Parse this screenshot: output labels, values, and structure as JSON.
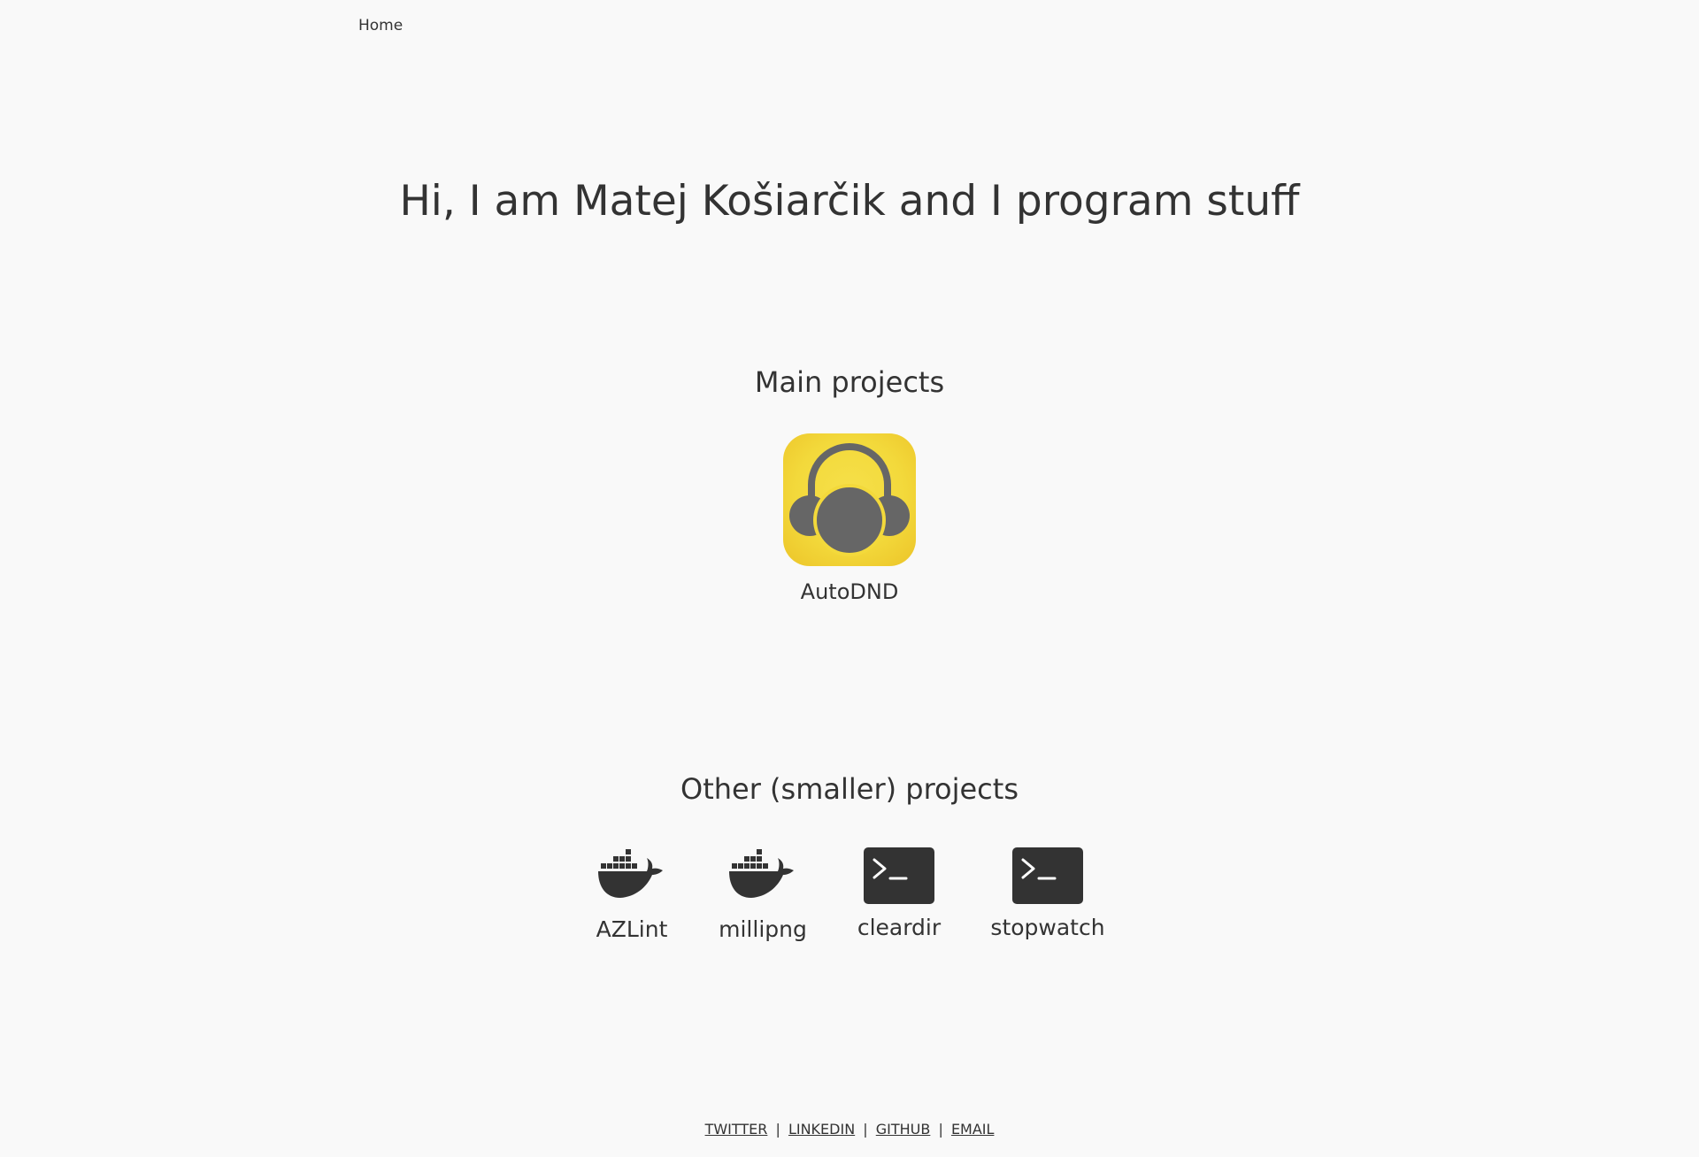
{
  "nav": {
    "home_label": "Home"
  },
  "hero": {
    "title": "Hi, I am Matej Košiarčik and I program stuff"
  },
  "main_section": {
    "heading": "Main projects",
    "projects": [
      {
        "name": "AutoDND",
        "icon": "headphones-icon"
      }
    ]
  },
  "other_section": {
    "heading": "Other (smaller) projects",
    "projects": [
      {
        "name": "AZLint",
        "icon": "docker-whale-icon"
      },
      {
        "name": "millipng",
        "icon": "docker-whale-icon"
      },
      {
        "name": "cleardir",
        "icon": "terminal-icon"
      },
      {
        "name": "stopwatch",
        "icon": "terminal-icon"
      }
    ]
  },
  "footer": {
    "links": [
      "TWITTER",
      "LINKEDIN",
      "GITHUB",
      "EMAIL"
    ],
    "separator": "|"
  },
  "colors": {
    "background": "#f9f9f9",
    "text": "#333333",
    "icon_yellow": "#f3d93b",
    "icon_gray": "#666666"
  }
}
